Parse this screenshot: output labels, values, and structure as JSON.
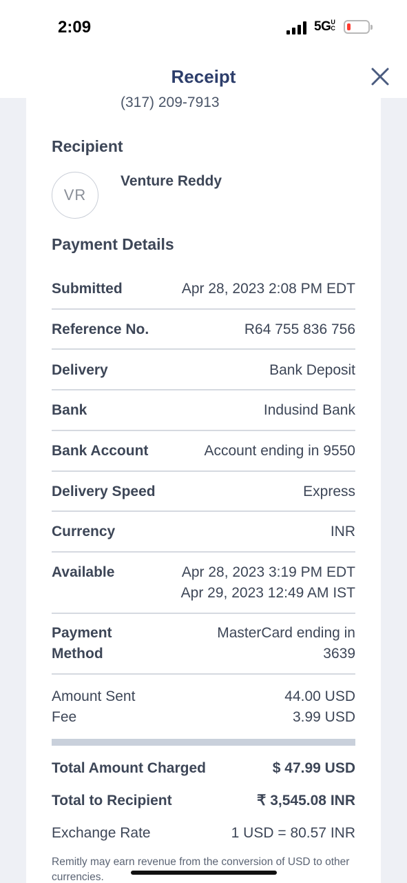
{
  "status_bar": {
    "time": "2:09",
    "network": "5G",
    "network_suffix": "UC"
  },
  "header": {
    "title": "Receipt"
  },
  "sender": {
    "phone": "(317) 209-7913"
  },
  "recipient": {
    "section_title": "Recipient",
    "initials": "VR",
    "name": "Venture Reddy"
  },
  "payment_details": {
    "section_title": "Payment Details",
    "rows": [
      {
        "label": "Submitted",
        "value": "Apr 28, 2023 2:08 PM EDT"
      },
      {
        "label": "Reference No.",
        "value": "R64 755 836 756"
      },
      {
        "label": "Delivery",
        "value": "Bank Deposit"
      },
      {
        "label": "Bank",
        "value": "Indusind Bank"
      },
      {
        "label": "Bank Account",
        "value": "Account ending in 9550"
      },
      {
        "label": "Delivery Speed",
        "value": "Express"
      },
      {
        "label": "Currency",
        "value": "INR"
      }
    ],
    "available": {
      "label": "Available",
      "value_line1": "Apr 28, 2023 3:19 PM EDT",
      "value_line2": "Apr 29, 2023 12:49 AM IST"
    },
    "payment_method": {
      "label_line1": "Payment",
      "label_line2": "Method",
      "value_line1": "MasterCard ending in",
      "value_line2": "3639"
    }
  },
  "amounts": {
    "amount_sent_label": "Amount Sent",
    "amount_sent_value": "44.00 USD",
    "fee_label": "Fee",
    "fee_value": "3.99 USD",
    "total_charged_label": "Total Amount Charged",
    "total_charged_value": "$ 47.99 USD",
    "total_recipient_label": "Total to Recipient",
    "total_recipient_value": "₹ 3,545.08 INR",
    "exchange_rate_label": "Exchange Rate",
    "exchange_rate_value": "1 USD = 80.57 INR"
  },
  "disclaimer": "Remitly may earn revenue from the conversion of USD to other currencies."
}
